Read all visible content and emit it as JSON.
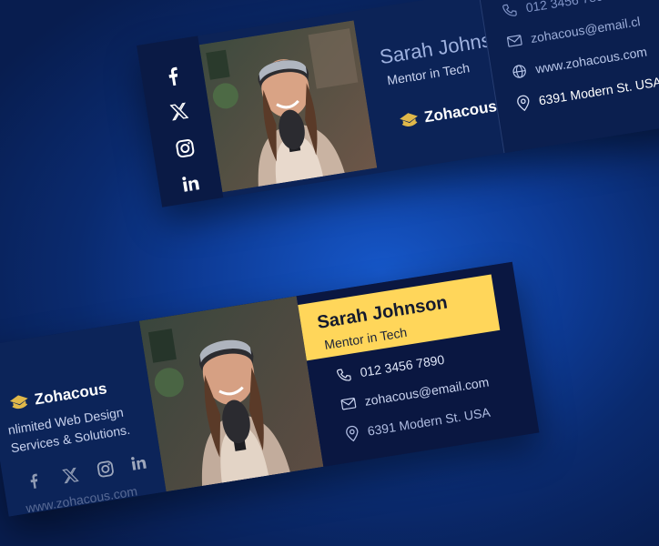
{
  "brand": {
    "name": "Zohacous"
  },
  "person": {
    "name": "Sarah Johnson",
    "role": "Mentor in Tech"
  },
  "contact": {
    "phone": "012 3456 7890",
    "email": "zohacous@email.com",
    "website": "www.zohacous.com",
    "address": "6391 Modern St. USA"
  },
  "card_top": {
    "social_icons": [
      "facebook-icon",
      "x-icon",
      "instagram-icon",
      "linkedin-icon"
    ],
    "email_shown": "zohacous@email.cl"
  },
  "card_bottom": {
    "tagline_line1": "nlimited Web Design",
    "tagline_line2": "Services & Solutions.",
    "website_partial": "www.zohacous.com",
    "social_icons": [
      "facebook-icon",
      "x-icon",
      "instagram-icon",
      "linkedin-icon"
    ]
  },
  "colors": {
    "background": "#0d3a94",
    "card": "#0c2357",
    "accent_yellow": "#ffd65a",
    "logo_gold": "#e0b84a"
  }
}
